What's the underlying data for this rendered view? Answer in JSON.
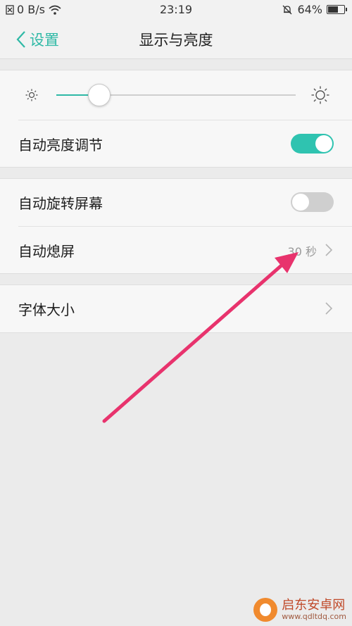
{
  "status_bar": {
    "speed": "0 B/s",
    "time": "23:19",
    "battery": "64%",
    "battery_level": 0.64
  },
  "nav": {
    "back_label": "设置",
    "title": "显示与亮度"
  },
  "brightness": {
    "level": 0.18
  },
  "rows": {
    "auto_brightness": {
      "label": "自动亮度调节",
      "on": true
    },
    "auto_rotate": {
      "label": "自动旋转屏幕",
      "on": false
    },
    "screen_timeout": {
      "label": "自动熄屏",
      "value": "30 秒"
    },
    "font_size": {
      "label": "字体大小"
    }
  },
  "watermark": {
    "title": "启东安卓网",
    "url": "www.qdltdq.com"
  },
  "colors": {
    "accent": "#2fb9a6",
    "annotation_arrow": "#e8336d"
  }
}
